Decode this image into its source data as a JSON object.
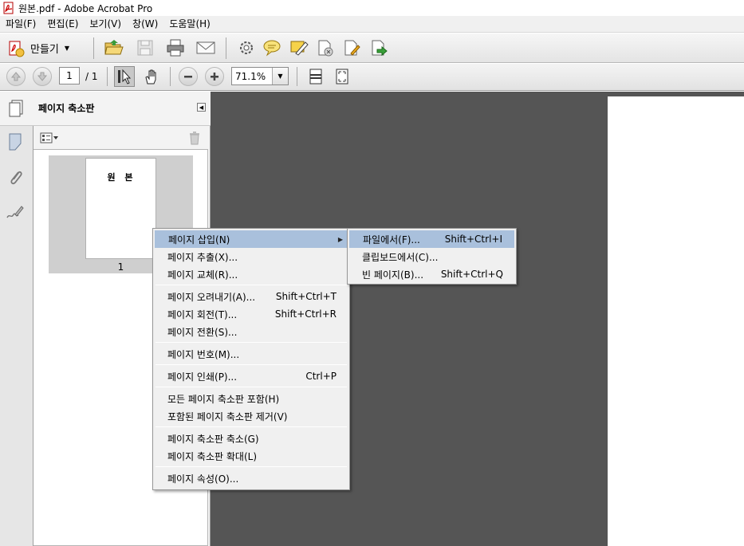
{
  "window": {
    "title": "원본.pdf - Adobe Acrobat Pro"
  },
  "menubar": {
    "items": [
      "파일(F)",
      "편집(E)",
      "보기(V)",
      "창(W)",
      "도움말(H)"
    ]
  },
  "toolbar": {
    "create_label": "만들기"
  },
  "navigation": {
    "current_page": "1",
    "total_pages": "/ 1",
    "zoom": "71.1%"
  },
  "panel": {
    "title": "페이지 축소판",
    "thumbnail_text": "원 본",
    "thumbnail_number": "1"
  },
  "context_menu": {
    "items": [
      {
        "label": "페이지 삽입(N)",
        "shortcut": ""
      },
      {
        "label": "페이지 추출(X)...",
        "shortcut": ""
      },
      {
        "label": "페이지 교체(R)...",
        "shortcut": ""
      },
      {
        "label": "페이지 오려내기(A)...",
        "shortcut": "Shift+Ctrl+T"
      },
      {
        "label": "페이지 회전(T)...",
        "shortcut": "Shift+Ctrl+R"
      },
      {
        "label": "페이지 전환(S)...",
        "shortcut": ""
      },
      {
        "label": "페이지 번호(M)...",
        "shortcut": ""
      },
      {
        "label": "페이지 인쇄(P)...",
        "shortcut": "Ctrl+P"
      },
      {
        "label": "모든 페이지 축소판 포함(H)",
        "shortcut": ""
      },
      {
        "label": "포함된 페이지 축소판 제거(V)",
        "shortcut": ""
      },
      {
        "label": "페이지 축소판 축소(G)",
        "shortcut": ""
      },
      {
        "label": "페이지 축소판 확대(L)",
        "shortcut": ""
      },
      {
        "label": "페이지 속성(O)...",
        "shortcut": ""
      }
    ]
  },
  "submenu": {
    "items": [
      {
        "label": "파일에서(F)...",
        "shortcut": "Shift+Ctrl+I"
      },
      {
        "label": "클립보드에서(C)...",
        "shortcut": ""
      },
      {
        "label": "빈 페이지(B)...",
        "shortcut": "Shift+Ctrl+Q"
      }
    ]
  },
  "colors": {
    "menu_highlight": "#a9c0dc",
    "doc_background": "#555555"
  }
}
